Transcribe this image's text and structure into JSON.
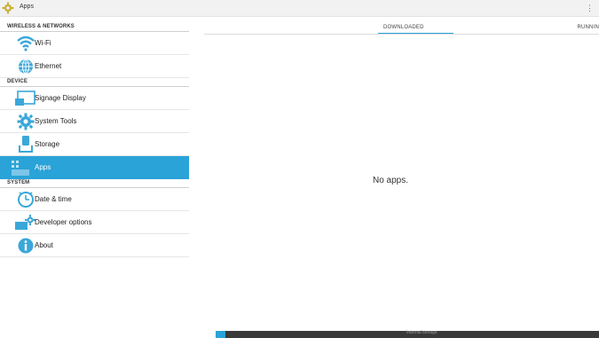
{
  "actionbar": {
    "title": "Apps",
    "icon": "settings-gear-icon",
    "overflow_glyph": "⋮"
  },
  "sections": [
    {
      "header": "WIRELESS & NETWORKS",
      "items": [
        {
          "label": "Wi-Fi",
          "icon": "wifi-icon"
        },
        {
          "label": "Ethernet",
          "icon": "ethernet-globe-icon"
        }
      ]
    },
    {
      "header": "DEVICE",
      "items": [
        {
          "label": "Signage Display",
          "icon": "display-icon"
        },
        {
          "label": "System Tools",
          "icon": "gear-icon"
        },
        {
          "label": "Storage",
          "icon": "storage-icon"
        },
        {
          "label": "Apps",
          "icon": "apps-grid-icon",
          "selected": true
        }
      ]
    },
    {
      "header": "SYSTEM",
      "items": [
        {
          "label": "Date & time",
          "icon": "clock-icon"
        },
        {
          "label": "Developer options",
          "icon": "developer-icon"
        },
        {
          "label": "About",
          "icon": "info-icon"
        }
      ]
    }
  ],
  "tabs": {
    "downloaded": "DOWNLOADED",
    "running": "RUNNIN"
  },
  "empty_message": "No apps.",
  "storage_bar": {
    "label": "Internal storage",
    "used_fraction": 0.025
  },
  "colors": {
    "accent": "#2aa3d8",
    "icon_blue": "#3aa7d9"
  }
}
